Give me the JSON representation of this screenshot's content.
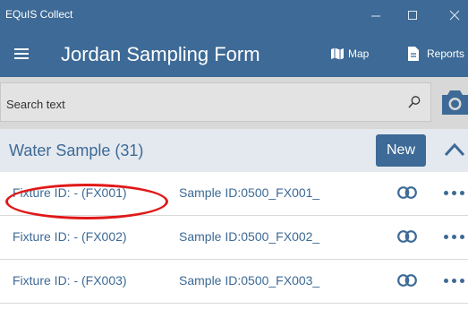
{
  "window": {
    "app_title": "EQuIS Collect",
    "controls": [
      "minimize",
      "maximize",
      "close"
    ]
  },
  "header": {
    "form_title": "Jordan Sampling Form",
    "map_label": "Map",
    "reports_label": "Reports",
    "icons": [
      "hamburger-menu-icon",
      "map-icon",
      "reports-icon"
    ]
  },
  "search": {
    "placeholder": "Search text",
    "value": ""
  },
  "section": {
    "title": "Water Sample (31)",
    "new_label": "New",
    "collapsed": false
  },
  "rows": [
    {
      "fixture": "Fixture ID:  - (FX001)",
      "sample": "Sample ID:0500_FX001_"
    },
    {
      "fixture": "Fixture ID:  - (FX002)",
      "sample": "Sample ID:0500_FX002_"
    },
    {
      "fixture": "Fixture ID:  - (FX003)",
      "sample": "Sample ID:0500_FX003_"
    }
  ],
  "colors": {
    "header": "#3d6a96",
    "section_bg": "#e4e9ef",
    "search_bg": "#d8d8d8",
    "annotation": "#e01818"
  }
}
